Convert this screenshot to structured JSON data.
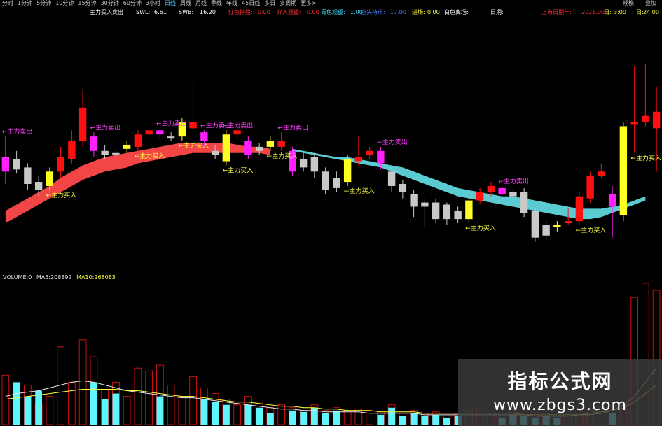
{
  "toolbar": {
    "tabs": [
      "分时",
      "1分钟",
      "5分钟",
      "10分钟",
      "15分钟",
      "30分钟",
      "60分钟",
      "3小时",
      "日线",
      "周线",
      "月线",
      "季线",
      "年线",
      "45日线",
      "多日",
      "多周期",
      "更多>"
    ],
    "active_tab": "日线",
    "right_label_1": "规模",
    "right_label_2": "叠加"
  },
  "indicator_line": {
    "title": "主力买入卖出",
    "swl": "SWL:",
    "swl_value": "6.61",
    "swb": "SWB:",
    "swb_value": "16.20",
    "red_label": "红色持股:",
    "red_value": "0.00",
    "orange_label": "介入观望:",
    "orange_value": "0.00",
    "cyan_label": "青色观望:",
    "cyan_value": "1.00",
    "blue_label": "空头持币:",
    "blue_value": "17.00",
    "yellow_label": "进场:",
    "yellow_value": "0.00",
    "white_label": "白色离场:",
    "white_value": "",
    "date_label": "日期:",
    "year_label": "上市日期年:",
    "year_value": "2021.00",
    "hour_label": "日:",
    "hour_value": "3:00",
    "day_label": "日:",
    "day_value": "24.00"
  },
  "colors": {
    "red_candle": "#ff1010",
    "white_candle": "#c8c8c8",
    "magenta_candle": "#ff20ff",
    "yellow_candle": "#ffff20",
    "red_band": "#ff4a4a",
    "cyan_band": "#5fd7dc",
    "label_magenta": "#ff40ff",
    "label_yellow": "#ffff40",
    "vol_cyan": "#5ff5ff",
    "vol_red": "#ff3030",
    "vol_outline": "#c81010",
    "ma5_color": "#e8e8e8",
    "ma10_color": "#ffff40"
  },
  "volume_legend": {
    "name": "VOLUME:0",
    "ma5": "MA5:",
    "ma5_value": "208892",
    "ma10": "MA10:",
    "ma10_value": "268083"
  },
  "watermark": {
    "cn": "指标公式网",
    "url": "www.zbgs3.com"
  },
  "chart_data": {
    "type": "candlestick",
    "title": "主力买入卖出",
    "y_range": [
      0,
      100
    ],
    "candles": [
      {
        "color": "magenta",
        "o": 46,
        "c": 53,
        "h": 63,
        "l": 40
      },
      {
        "color": "white",
        "o": 52,
        "c": 47,
        "h": 56,
        "l": 45
      },
      {
        "color": "white",
        "o": 48,
        "c": 40,
        "h": 50,
        "l": 37
      },
      {
        "color": "white",
        "o": 41,
        "c": 37,
        "h": 44,
        "l": 34
      },
      {
        "color": "yellow",
        "o": 39,
        "c": 46,
        "h": 48,
        "l": 37
      },
      {
        "color": "red",
        "o": 46,
        "c": 53,
        "h": 58,
        "l": 43
      },
      {
        "color": "red",
        "o": 52,
        "c": 61,
        "h": 66,
        "l": 50
      },
      {
        "color": "red",
        "o": 61,
        "c": 77,
        "h": 86,
        "l": 58
      },
      {
        "color": "magenta",
        "o": 63,
        "c": 56,
        "h": 65,
        "l": 53
      },
      {
        "color": "white",
        "o": 56,
        "c": 54,
        "h": 59,
        "l": 52
      },
      {
        "color": "white",
        "o": 55,
        "c": 54,
        "h": 57,
        "l": 52
      },
      {
        "color": "yellow",
        "o": 57,
        "c": 59,
        "h": 61,
        "l": 55
      },
      {
        "color": "red",
        "o": 58,
        "c": 64,
        "h": 66,
        "l": 56
      },
      {
        "color": "red",
        "o": 64,
        "c": 66,
        "h": 68,
        "l": 62
      },
      {
        "color": "magenta",
        "o": 66,
        "c": 64,
        "h": 67,
        "l": 62
      },
      {
        "color": "white",
        "o": 63,
        "c": 63,
        "h": 65,
        "l": 61
      },
      {
        "color": "yellow",
        "o": 63,
        "c": 70,
        "h": 72,
        "l": 61
      },
      {
        "color": "red",
        "o": 67,
        "c": 70,
        "h": 89,
        "l": 65
      },
      {
        "color": "magenta",
        "o": 65,
        "c": 61,
        "h": 66,
        "l": 58
      },
      {
        "color": "white",
        "o": 56,
        "c": 54,
        "h": 59,
        "l": 52
      },
      {
        "color": "yellow",
        "o": 64,
        "c": 51,
        "h": 66,
        "l": 49
      },
      {
        "color": "red",
        "o": 64,
        "c": 66,
        "h": 68,
        "l": 62
      },
      {
        "color": "magenta",
        "o": 61,
        "c": 54,
        "h": 63,
        "l": 52
      },
      {
        "color": "white",
        "o": 58,
        "c": 56,
        "h": 60,
        "l": 54
      },
      {
        "color": "yellow",
        "o": 61,
        "c": 58,
        "h": 63,
        "l": 56
      },
      {
        "color": "red",
        "o": 58,
        "c": 61,
        "h": 65,
        "l": 56
      },
      {
        "color": "magenta",
        "o": 56,
        "c": 46,
        "h": 58,
        "l": 44
      },
      {
        "color": "white",
        "o": 52,
        "c": 48,
        "h": 55,
        "l": 46
      },
      {
        "color": "white",
        "o": 53,
        "c": 46,
        "h": 55,
        "l": 43
      },
      {
        "color": "white",
        "o": 46,
        "c": 37,
        "h": 48,
        "l": 35
      },
      {
        "color": "white",
        "o": 43,
        "c": 38,
        "h": 46,
        "l": 36
      },
      {
        "color": "yellow",
        "o": 41,
        "c": 52,
        "h": 54,
        "l": 39
      },
      {
        "color": "red",
        "o": 51,
        "c": 53,
        "h": 63,
        "l": 49
      },
      {
        "color": "red",
        "o": 54,
        "c": 56,
        "h": 58,
        "l": 52
      },
      {
        "color": "magenta",
        "o": 56,
        "c": 50,
        "h": 58,
        "l": 47
      },
      {
        "color": "white",
        "o": 46,
        "c": 39,
        "h": 48,
        "l": 36
      },
      {
        "color": "white",
        "o": 40,
        "c": 36,
        "h": 42,
        "l": 33
      },
      {
        "color": "white",
        "o": 35,
        "c": 29,
        "h": 37,
        "l": 24
      },
      {
        "color": "white",
        "o": 31,
        "c": 29,
        "h": 33,
        "l": 19
      },
      {
        "color": "white",
        "o": 31,
        "c": 23,
        "h": 33,
        "l": 21
      },
      {
        "color": "white",
        "o": 30,
        "c": 23,
        "h": 31,
        "l": 20
      },
      {
        "color": "white",
        "o": 27,
        "c": 23,
        "h": 29,
        "l": 21
      },
      {
        "color": "yellow",
        "o": 23,
        "c": 32,
        "h": 34,
        "l": 21
      },
      {
        "color": "red",
        "o": 32,
        "c": 36,
        "h": 38,
        "l": 30
      },
      {
        "color": "red",
        "o": 36,
        "c": 39,
        "h": 41,
        "l": 34
      },
      {
        "color": "magenta",
        "o": 38,
        "c": 35,
        "h": 39,
        "l": 33
      },
      {
        "color": "white",
        "o": 36,
        "c": 34,
        "h": 37,
        "l": 31
      },
      {
        "color": "white",
        "o": 36,
        "c": 26,
        "h": 38,
        "l": 24
      },
      {
        "color": "white",
        "o": 27,
        "c": 14,
        "h": 28,
        "l": 12
      },
      {
        "color": "white",
        "o": 20,
        "c": 15,
        "h": 22,
        "l": 13
      },
      {
        "color": "yellow",
        "o": 20,
        "c": 19,
        "h": 22,
        "l": 17
      },
      {
        "color": "red",
        "o": 21,
        "c": 22,
        "h": 28,
        "l": 20
      },
      {
        "color": "red",
        "o": 22,
        "c": 34,
        "h": 36,
        "l": 20
      },
      {
        "color": "red",
        "o": 33,
        "c": 44,
        "h": 46,
        "l": 31
      },
      {
        "color": "red",
        "o": 44,
        "c": 46,
        "h": 50,
        "l": 43
      },
      {
        "color": "magenta",
        "o": 35,
        "c": 29,
        "h": 39,
        "l": 14
      },
      {
        "color": "yellow",
        "o": 25,
        "c": 68,
        "h": 70,
        "l": 22
      },
      {
        "color": "red",
        "o": 69,
        "c": 70,
        "h": 97,
        "l": 55
      },
      {
        "color": "red",
        "o": 70,
        "c": 73,
        "h": 98,
        "l": 68
      },
      {
        "color": "red",
        "o": 67,
        "c": 75,
        "h": 87,
        "l": 46
      }
    ],
    "red_band": {
      "upper": [
        27,
        30,
        33,
        36,
        39,
        43,
        46,
        49,
        51,
        53,
        54,
        55,
        56,
        57,
        58,
        59,
        60,
        60,
        60,
        60,
        60,
        59,
        58,
        58,
        57
      ],
      "lower": [
        21,
        24,
        27,
        30,
        33,
        36,
        39,
        42,
        44,
        46,
        47,
        48,
        50,
        51,
        52,
        53,
        54,
        55,
        55,
        55,
        55,
        55,
        55,
        55,
        54
      ]
    },
    "cyan_band": {
      "upper": [
        57,
        56,
        55,
        54,
        53,
        53,
        52,
        51,
        50,
        49,
        48,
        46,
        44,
        42,
        40,
        38,
        37,
        36,
        35,
        34,
        34,
        33,
        32,
        31,
        30,
        29,
        28,
        28,
        28,
        29,
        30,
        32,
        34
      ],
      "lower": [
        56,
        55,
        54,
        53,
        52,
        51,
        50,
        49,
        48,
        46,
        44,
        42,
        40,
        38,
        36,
        34,
        33,
        32,
        31,
        30,
        29,
        28,
        27,
        26,
        25,
        24,
        23,
        23,
        24,
        26,
        28,
        30,
        32
      ],
      "start_index": 26
    },
    "annotations": [
      {
        "text": "←主力卖出",
        "type": "sell",
        "index": 0
      },
      {
        "text": "←主力卖出",
        "type": "sell",
        "index": 8
      },
      {
        "text": "←主力买入",
        "type": "buy",
        "index": 4
      },
      {
        "text": "←主力卖出",
        "type": "sell",
        "index": 14
      },
      {
        "text": "←主力卖出",
        "type": "sell",
        "index": 18
      },
      {
        "text": "←主力买入",
        "type": "buy",
        "index": 12
      },
      {
        "text": "←主力买入",
        "type": "buy",
        "index": 16
      },
      {
        "text": "←主力卖出",
        "type": "sell",
        "index": 20
      },
      {
        "text": "←主力卖出",
        "type": "sell",
        "index": 25
      },
      {
        "text": "←主力买入",
        "type": "buy",
        "index": 20
      },
      {
        "text": "←主力买入",
        "type": "buy",
        "index": 24
      },
      {
        "text": "←主力卖出",
        "type": "sell",
        "index": 34
      },
      {
        "text": "←主力买入",
        "type": "buy",
        "index": 31
      },
      {
        "text": "←主力卖出",
        "type": "sell",
        "index": 45
      },
      {
        "text": "←主力买入",
        "type": "buy",
        "index": 42
      },
      {
        "text": "←主力买入",
        "type": "buy",
        "index": 52
      },
      {
        "text": "←主力买入",
        "type": "buy",
        "index": 57
      }
    ],
    "volume": {
      "y_range": [
        0,
        100
      ],
      "bars": [
        15,
        30,
        20,
        24,
        18,
        40,
        22,
        45,
        30,
        18,
        22,
        14,
        30,
        22,
        20,
        18,
        14,
        26,
        18,
        16,
        14,
        10,
        14,
        12,
        8,
        12,
        10,
        9,
        12,
        8,
        10,
        8,
        9,
        8,
        7,
        12,
        6,
        8,
        6,
        7,
        5,
        6,
        8,
        10,
        6,
        5,
        7,
        6,
        5,
        6,
        5,
        5,
        6,
        8,
        10,
        8,
        12,
        60,
        100,
        85
      ],
      "outline": [
        35,
        22,
        28,
        15,
        20,
        55,
        30,
        60,
        48,
        25,
        30,
        20,
        40,
        38,
        42,
        28,
        20,
        34,
        26,
        22,
        18,
        14,
        20,
        16,
        12,
        14,
        12,
        10,
        14,
        10,
        12,
        10,
        11,
        10,
        9,
        14,
        8,
        10,
        8,
        9,
        7,
        8,
        10,
        12,
        8,
        7,
        9,
        8,
        7,
        8,
        7,
        7,
        8,
        10,
        12,
        10,
        14,
        90,
        100,
        95
      ],
      "ma5": [
        20,
        22,
        23,
        24,
        26,
        28,
        30,
        31,
        30,
        28,
        26,
        24,
        23,
        22,
        21,
        20,
        19,
        19,
        18,
        17,
        16,
        15,
        14,
        13,
        12,
        11,
        11,
        10,
        10,
        9,
        9,
        9,
        9,
        8,
        8,
        8,
        8,
        8,
        7,
        7,
        7,
        7,
        7,
        7,
        7,
        7,
        7,
        7,
        6,
        6,
        6,
        6,
        7,
        7,
        8,
        10,
        14,
        20,
        30,
        40
      ],
      "ma10": [
        18,
        19,
        20,
        21,
        22,
        23,
        24,
        25,
        25,
        25,
        25,
        24,
        24,
        23,
        22,
        21,
        20,
        20,
        19,
        18,
        17,
        16,
        16,
        15,
        14,
        13,
        13,
        12,
        12,
        11,
        11,
        10,
        10,
        10,
        9,
        9,
        9,
        9,
        8,
        8,
        8,
        8,
        8,
        8,
        8,
        8,
        8,
        7,
        7,
        7,
        7,
        7,
        7,
        8,
        9,
        10,
        12,
        16,
        22,
        28
      ]
    }
  }
}
